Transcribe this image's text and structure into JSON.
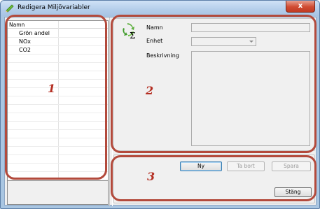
{
  "window": {
    "title": "Redigera Miljövariabler",
    "close_glyph": "x"
  },
  "list": {
    "column_header": "Namn",
    "items": [
      "Grön andel",
      "NOx",
      "CO2",
      "",
      "",
      "",
      "",
      "",
      "",
      "",
      "",
      "",
      "",
      "",
      "",
      "",
      "",
      ""
    ]
  },
  "details": {
    "name_label": "Namn",
    "unit_label": "Enhet",
    "description_label": "Beskrivning",
    "name_value": "",
    "unit_value": "",
    "description_value": ""
  },
  "buttons": {
    "new": "Ny",
    "delete": "Ta bort",
    "save": "Spara",
    "close": "Stäng"
  },
  "annotations": [
    "1",
    "2",
    "3"
  ],
  "colors": {
    "annotation": "#b34a3c",
    "title_gradient_top": "#cfe2f6",
    "close_button": "#cf4b32"
  },
  "icons": {
    "app": "edit-pencil-icon",
    "details": "recycle-sigma-icon"
  }
}
